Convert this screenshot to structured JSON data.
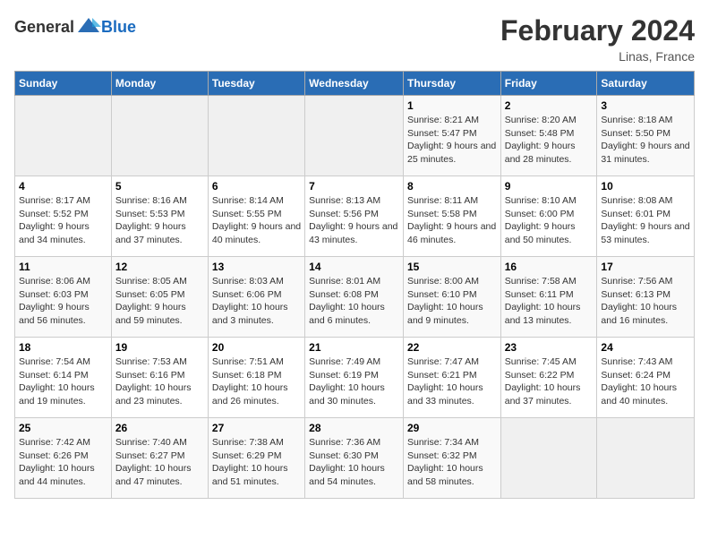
{
  "header": {
    "logo_general": "General",
    "logo_blue": "Blue",
    "month_year": "February 2024",
    "location": "Linas, France"
  },
  "weekdays": [
    "Sunday",
    "Monday",
    "Tuesday",
    "Wednesday",
    "Thursday",
    "Friday",
    "Saturday"
  ],
  "weeks": [
    [
      {
        "num": "",
        "detail": ""
      },
      {
        "num": "",
        "detail": ""
      },
      {
        "num": "",
        "detail": ""
      },
      {
        "num": "",
        "detail": ""
      },
      {
        "num": "1",
        "detail": "Sunrise: 8:21 AM\nSunset: 5:47 PM\nDaylight: 9 hours and 25 minutes."
      },
      {
        "num": "2",
        "detail": "Sunrise: 8:20 AM\nSunset: 5:48 PM\nDaylight: 9 hours and 28 minutes."
      },
      {
        "num": "3",
        "detail": "Sunrise: 8:18 AM\nSunset: 5:50 PM\nDaylight: 9 hours and 31 minutes."
      }
    ],
    [
      {
        "num": "4",
        "detail": "Sunrise: 8:17 AM\nSunset: 5:52 PM\nDaylight: 9 hours and 34 minutes."
      },
      {
        "num": "5",
        "detail": "Sunrise: 8:16 AM\nSunset: 5:53 PM\nDaylight: 9 hours and 37 minutes."
      },
      {
        "num": "6",
        "detail": "Sunrise: 8:14 AM\nSunset: 5:55 PM\nDaylight: 9 hours and 40 minutes."
      },
      {
        "num": "7",
        "detail": "Sunrise: 8:13 AM\nSunset: 5:56 PM\nDaylight: 9 hours and 43 minutes."
      },
      {
        "num": "8",
        "detail": "Sunrise: 8:11 AM\nSunset: 5:58 PM\nDaylight: 9 hours and 46 minutes."
      },
      {
        "num": "9",
        "detail": "Sunrise: 8:10 AM\nSunset: 6:00 PM\nDaylight: 9 hours and 50 minutes."
      },
      {
        "num": "10",
        "detail": "Sunrise: 8:08 AM\nSunset: 6:01 PM\nDaylight: 9 hours and 53 minutes."
      }
    ],
    [
      {
        "num": "11",
        "detail": "Sunrise: 8:06 AM\nSunset: 6:03 PM\nDaylight: 9 hours and 56 minutes."
      },
      {
        "num": "12",
        "detail": "Sunrise: 8:05 AM\nSunset: 6:05 PM\nDaylight: 9 hours and 59 minutes."
      },
      {
        "num": "13",
        "detail": "Sunrise: 8:03 AM\nSunset: 6:06 PM\nDaylight: 10 hours and 3 minutes."
      },
      {
        "num": "14",
        "detail": "Sunrise: 8:01 AM\nSunset: 6:08 PM\nDaylight: 10 hours and 6 minutes."
      },
      {
        "num": "15",
        "detail": "Sunrise: 8:00 AM\nSunset: 6:10 PM\nDaylight: 10 hours and 9 minutes."
      },
      {
        "num": "16",
        "detail": "Sunrise: 7:58 AM\nSunset: 6:11 PM\nDaylight: 10 hours and 13 minutes."
      },
      {
        "num": "17",
        "detail": "Sunrise: 7:56 AM\nSunset: 6:13 PM\nDaylight: 10 hours and 16 minutes."
      }
    ],
    [
      {
        "num": "18",
        "detail": "Sunrise: 7:54 AM\nSunset: 6:14 PM\nDaylight: 10 hours and 19 minutes."
      },
      {
        "num": "19",
        "detail": "Sunrise: 7:53 AM\nSunset: 6:16 PM\nDaylight: 10 hours and 23 minutes."
      },
      {
        "num": "20",
        "detail": "Sunrise: 7:51 AM\nSunset: 6:18 PM\nDaylight: 10 hours and 26 minutes."
      },
      {
        "num": "21",
        "detail": "Sunrise: 7:49 AM\nSunset: 6:19 PM\nDaylight: 10 hours and 30 minutes."
      },
      {
        "num": "22",
        "detail": "Sunrise: 7:47 AM\nSunset: 6:21 PM\nDaylight: 10 hours and 33 minutes."
      },
      {
        "num": "23",
        "detail": "Sunrise: 7:45 AM\nSunset: 6:22 PM\nDaylight: 10 hours and 37 minutes."
      },
      {
        "num": "24",
        "detail": "Sunrise: 7:43 AM\nSunset: 6:24 PM\nDaylight: 10 hours and 40 minutes."
      }
    ],
    [
      {
        "num": "25",
        "detail": "Sunrise: 7:42 AM\nSunset: 6:26 PM\nDaylight: 10 hours and 44 minutes."
      },
      {
        "num": "26",
        "detail": "Sunrise: 7:40 AM\nSunset: 6:27 PM\nDaylight: 10 hours and 47 minutes."
      },
      {
        "num": "27",
        "detail": "Sunrise: 7:38 AM\nSunset: 6:29 PM\nDaylight: 10 hours and 51 minutes."
      },
      {
        "num": "28",
        "detail": "Sunrise: 7:36 AM\nSunset: 6:30 PM\nDaylight: 10 hours and 54 minutes."
      },
      {
        "num": "29",
        "detail": "Sunrise: 7:34 AM\nSunset: 6:32 PM\nDaylight: 10 hours and 58 minutes."
      },
      {
        "num": "",
        "detail": ""
      },
      {
        "num": "",
        "detail": ""
      }
    ]
  ]
}
